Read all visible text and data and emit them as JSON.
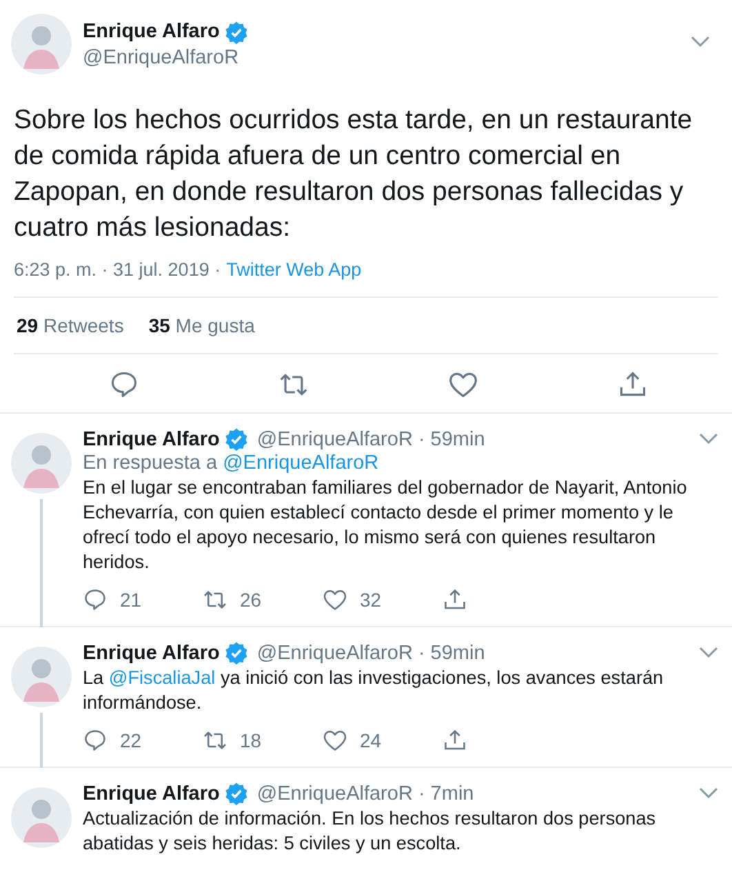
{
  "tweet": {
    "author": {
      "name": "Enrique Alfaro",
      "handle": "@EnriqueAlfaroR",
      "verified": true
    },
    "text": "Sobre los hechos ocurridos esta tarde, en un restaurante de comida rápida afuera de un centro comercial en Zapopan, en donde resultaron dos personas fallecidas y cuatro más lesionadas:",
    "time": "6:23 p. m. · 31 jul. 2019 ·",
    "source": "Twitter Web App",
    "stats": [
      {
        "count": "29",
        "label": "Retweets"
      },
      {
        "count": "35",
        "label": "Me gusta"
      }
    ]
  },
  "replies": [
    {
      "name": "Enrique Alfaro",
      "verified": true,
      "handle": "@EnriqueAlfaroR",
      "age": "· 59min",
      "reply_to": {
        "label": "En respuesta a",
        "handle": "@EnriqueAlfaroR"
      },
      "continues": true,
      "parts": [
        {
          "kind": "text",
          "text": "En el lugar se encontraban familiares del gobernador de Nayarit, Antonio Echevarría, con quien establecí contacto desde el primer momento y le ofrecí todo el apoyo necesario, lo mismo será con quienes resultaron heridos."
        }
      ],
      "replies": "21",
      "retweets": "26",
      "likes": "32"
    },
    {
      "name": "Enrique Alfaro",
      "verified": true,
      "handle": "@EnriqueAlfaroR",
      "age": "· 59min",
      "continues": true,
      "parts": [
        {
          "kind": "text",
          "text": "La "
        },
        {
          "kind": "mention",
          "text": "@FiscaliaJal"
        },
        {
          "kind": "text",
          "text": " ya inició con las investigaciones, los avances estarán informándose."
        }
      ],
      "replies": "22",
      "retweets": "18",
      "likes": "24"
    },
    {
      "name": "Enrique Alfaro",
      "verified": true,
      "handle": "@EnriqueAlfaroR",
      "age": "· 7min",
      "continues": false,
      "parts": [
        {
          "kind": "text",
          "text": "Actualización de información. En los hechos resultaron dos personas abatidas y seis heridas: 5 civiles y un escolta."
        }
      ]
    }
  ]
}
